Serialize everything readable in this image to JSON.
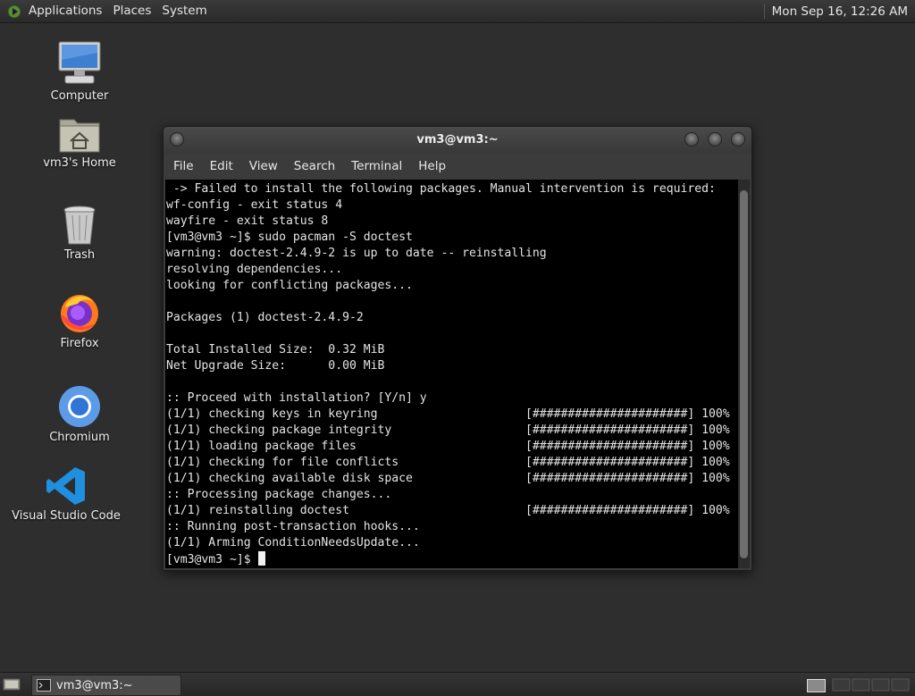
{
  "top_panel": {
    "menus": [
      "Applications",
      "Places",
      "System"
    ],
    "clock": "Mon Sep 16, 12:26 AM"
  },
  "desktop": {
    "icons": [
      {
        "label": "Computer",
        "icon": "computer-icon"
      },
      {
        "label": "vm3's Home",
        "icon": "home-folder-icon"
      },
      {
        "label": "Trash",
        "icon": "trash-icon"
      },
      {
        "label": "Firefox",
        "icon": "firefox-icon"
      },
      {
        "label": "Chromium",
        "icon": "chromium-icon"
      },
      {
        "label": "Visual Studio Code",
        "icon": "vscode-icon"
      }
    ]
  },
  "window": {
    "title": "vm3@vm3:~",
    "menu": [
      "File",
      "Edit",
      "View",
      "Search",
      "Terminal",
      "Help"
    ]
  },
  "terminal": {
    "lines": [
      " -> Failed to install the following packages. Manual intervention is required:",
      "wf-config - exit status 4",
      "wayfire - exit status 8",
      "[vm3@vm3 ~]$ sudo pacman -S doctest",
      "warning: doctest-2.4.9-2 is up to date -- reinstalling",
      "resolving dependencies...",
      "looking for conflicting packages...",
      "",
      "Packages (1) doctest-2.4.9-2",
      "",
      "Total Installed Size:  0.32 MiB",
      "Net Upgrade Size:      0.00 MiB",
      "",
      ":: Proceed with installation? [Y/n] y",
      "(1/1) checking keys in keyring                     [######################] 100%",
      "(1/1) checking package integrity                   [######################] 100%",
      "(1/1) loading package files                        [######################] 100%",
      "(1/1) checking for file conflicts                  [######################] 100%",
      "(1/1) checking available disk space                [######################] 100%",
      ":: Processing package changes...",
      "(1/1) reinstalling doctest                         [######################] 100%",
      ":: Running post-transaction hooks...",
      "(1/1) Arming ConditionNeedsUpdate..."
    ],
    "prompt": "[vm3@vm3 ~]$ "
  },
  "taskbar": {
    "task_label": "vm3@vm3:~"
  },
  "colors": {
    "desktop_bg": "#2e2e2e",
    "terminal_bg": "#000000",
    "terminal_fg": "#e4e4e4"
  }
}
